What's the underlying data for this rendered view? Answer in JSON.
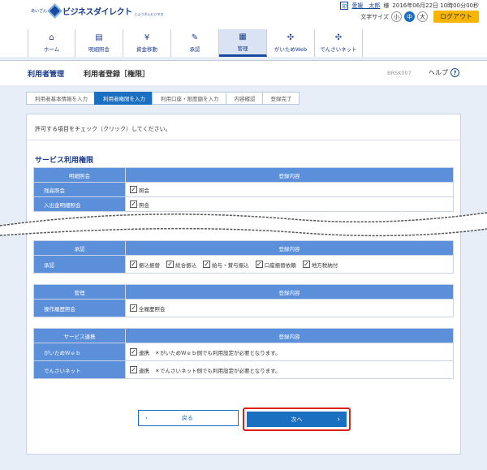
{
  "header": {
    "bank_small": "あいざん",
    "brand": "ビジネスダイレクト",
    "brand_sub": "じょうぎんビジネス",
    "user_icon": "印",
    "user_name": "愛媛　太郎",
    "user_suffix": "様",
    "datetime": "2016年06月22日 10時00分00秒",
    "font_size_label": "文字サイズ",
    "font_sizes": [
      "小",
      "中",
      "大"
    ],
    "logout": "ログアウト"
  },
  "nav": [
    {
      "label": "ホーム",
      "icon": "home-icon",
      "glyph": "⌂"
    },
    {
      "label": "明細照会",
      "icon": "document-icon",
      "glyph": "▤"
    },
    {
      "label": "資金移動",
      "icon": "yen-icon",
      "glyph": "¥"
    },
    {
      "label": "承認",
      "icon": "approve-icon",
      "glyph": "✎"
    },
    {
      "label": "管理",
      "icon": "admin-icon",
      "glyph": "▦"
    },
    {
      "label": "がいためWeb",
      "icon": "link-icon",
      "glyph": "✣"
    },
    {
      "label": "でんさいネット",
      "icon": "network-icon",
      "glyph": "✣"
    }
  ],
  "band": {
    "section": "利用者管理",
    "title": "利用者登録［権限］",
    "code": "BRSK007",
    "help": "ヘルプ"
  },
  "steps": [
    "利用者基本情報を入力",
    "利用者権限を入力",
    "利用口座・限度額を入力",
    "内容確認",
    "登録完了"
  ],
  "intro": "許可する項目をチェック（クリック）してください。",
  "section_title": "サービス利用権限",
  "tables": [
    {
      "head": [
        "明細照会",
        "登録内容"
      ],
      "rows": [
        {
          "label": "残高照会",
          "items": [
            "照会"
          ]
        },
        {
          "label": "入出金明細照会",
          "items": [
            "照会"
          ]
        }
      ]
    },
    {
      "head": [
        "承認",
        "登録内容"
      ],
      "rows": [
        {
          "label": "承認",
          "items": [
            "振込振替",
            "総合振込",
            "給与・賞与振込",
            "口座振替依頼",
            "地方税納付"
          ]
        }
      ]
    },
    {
      "head": [
        "管理",
        "登録内容"
      ],
      "rows": [
        {
          "label": "操作履歴照会",
          "items": [
            "全履歴照会"
          ]
        }
      ]
    },
    {
      "head": [
        "サービス連携",
        "登録内容"
      ],
      "rows": [
        {
          "label": "がいためＷｅｂ",
          "items": [
            "連携　＊がいためＷｅｂ側でも利用設定が必要となります。"
          ]
        },
        {
          "label": "でんさいネット",
          "items": [
            "連携　＊でんさいネット側でも利用設定が必要となります。"
          ]
        }
      ]
    }
  ],
  "buttons": {
    "back": "戻る",
    "back_icon": "‹",
    "next": "次へ",
    "next_icon": "›"
  },
  "colors": {
    "primary": "#1a6fc1",
    "header": "#5b8fd9",
    "highlight": "#d21"
  }
}
